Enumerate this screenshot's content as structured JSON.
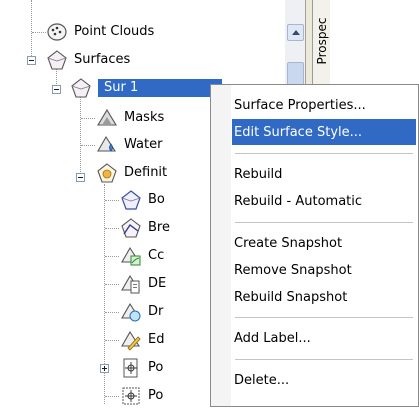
{
  "tree": {
    "items": [
      {
        "label": "Point Clouds",
        "icon": "point-clouds-icon"
      },
      {
        "label": "Surfaces",
        "icon": "surfaces-icon"
      },
      {
        "label": "Sur 1",
        "icon": "surface-icon",
        "selected": true
      },
      {
        "label": "Masks",
        "icon": "masks-icon"
      },
      {
        "label": "Water",
        "icon": "watershed-icon"
      },
      {
        "label": "Definit",
        "icon": "definition-icon"
      },
      {
        "label": "Bo",
        "icon": "boundaries-icon"
      },
      {
        "label": "Bre",
        "icon": "breaklines-icon"
      },
      {
        "label": "Cc",
        "icon": "contours-icon"
      },
      {
        "label": "DE",
        "icon": "dem-files-icon"
      },
      {
        "label": "Dr",
        "icon": "drawing-objects-icon"
      },
      {
        "label": "Ed",
        "icon": "edits-icon"
      },
      {
        "label": "Po",
        "icon": "point-files-icon"
      },
      {
        "label": "Po",
        "icon": "point-groups-icon"
      }
    ]
  },
  "side_tab": {
    "label": "Prospec"
  },
  "context_menu": {
    "items": [
      {
        "label": "Surface Properties...",
        "highlighted": false
      },
      {
        "label": "Edit Surface Style...",
        "highlighted": true
      },
      {
        "label": "Rebuild",
        "highlighted": false
      },
      {
        "label": "Rebuild - Automatic",
        "highlighted": false
      },
      {
        "label": "Create Snapshot",
        "highlighted": false
      },
      {
        "label": "Remove Snapshot",
        "highlighted": false
      },
      {
        "label": "Rebuild Snapshot",
        "highlighted": false
      },
      {
        "label": "Add Label...",
        "highlighted": false
      },
      {
        "label": "Delete...",
        "highlighted": false
      }
    ]
  },
  "colors": {
    "selection": "#316ac5",
    "menu_border": "#8a8a8a",
    "scroll_bg": "#eef0f4"
  }
}
